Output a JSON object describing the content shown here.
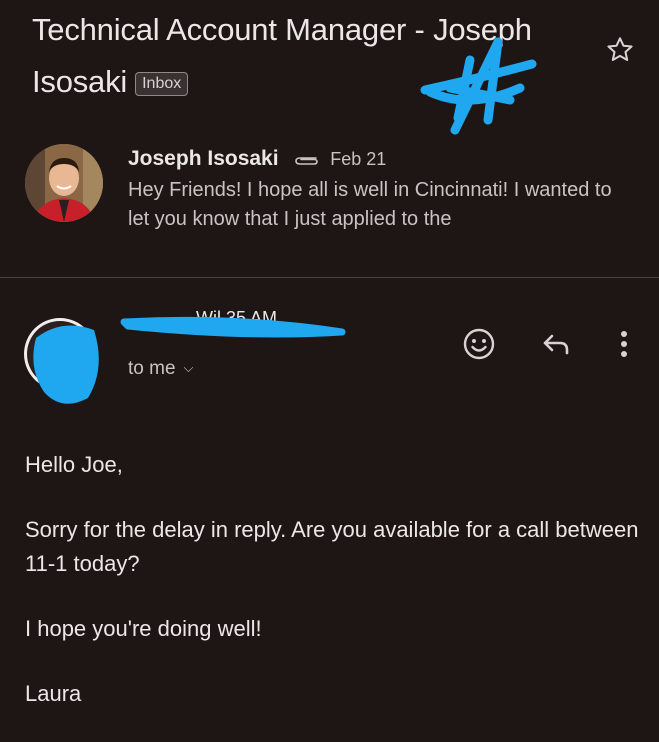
{
  "thread": {
    "subject": "Technical Account Manager - Joseph Isosaki",
    "label_chip": "Inbox",
    "star_icon": "star-outline-icon"
  },
  "collapsed_message": {
    "sender": "Joseph Isosaki",
    "has_attachment": true,
    "date": "Feb 21",
    "snippet": "Hey Friends! I hope all is well in Cincinnati! I wanted to let you know that I just applied to the"
  },
  "expanded_message": {
    "recipient_summary": "to me",
    "actions": [
      "emoji-reaction-icon",
      "reply-icon",
      "more-vert-icon"
    ],
    "body": {
      "greeting": "Hello Joe,",
      "paragraph": "Sorry for the delay in reply. Are you available for a call between 11-1 today?",
      "closing_line": "I hope you're doing well!",
      "signature": "Laura"
    }
  },
  "colors": {
    "background": "#1e1515",
    "redaction": "#1fa8ef",
    "text_primary": "#ece7e7",
    "text_secondary": "#c9c3c3"
  }
}
